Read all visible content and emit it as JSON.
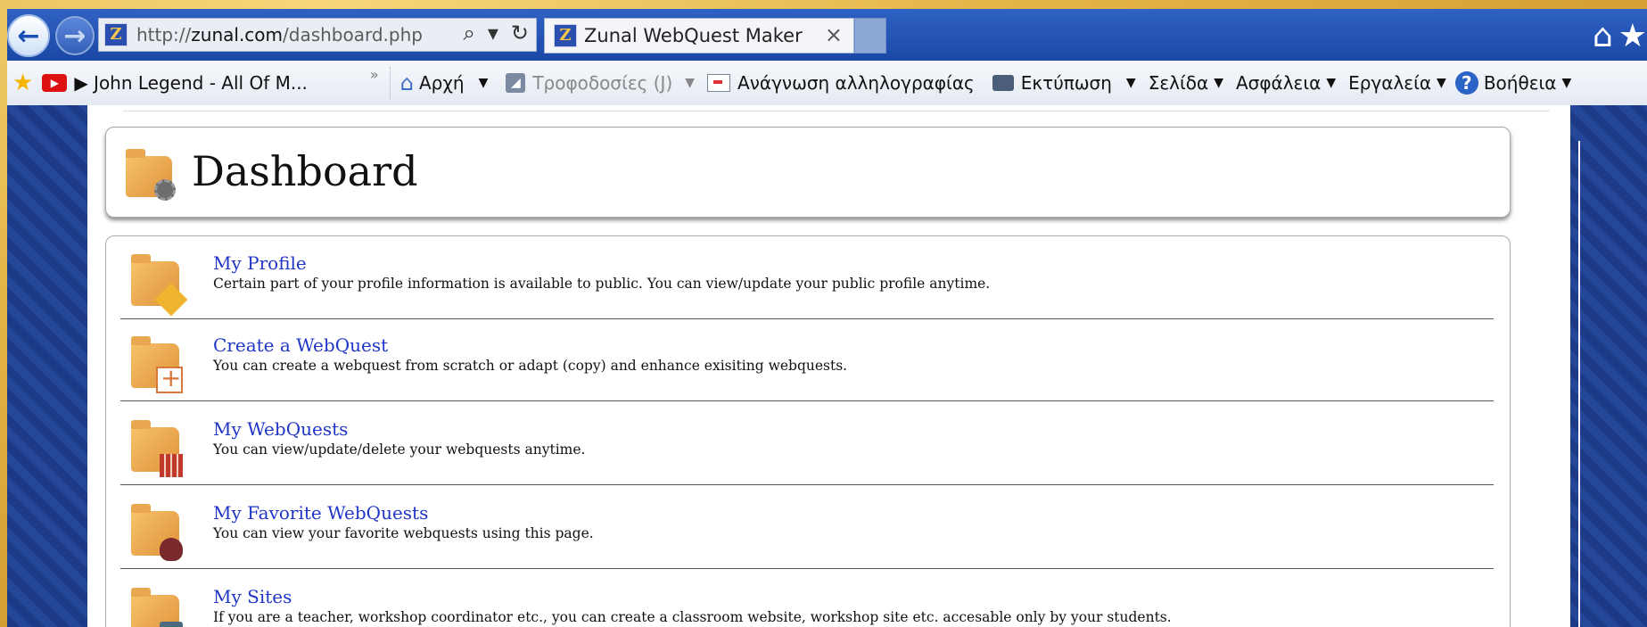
{
  "browser": {
    "url_prefix": "http://",
    "url_host": "zunal.com",
    "url_path": "/dashboard.php",
    "tab_title": "Zunal WebQuest Maker",
    "tab_close": "×",
    "search_glyph": "⌕",
    "dropdown_glyph": "▾",
    "refresh_glyph": "↻",
    "back_glyph": "←",
    "forward_glyph": "→",
    "home_glyph": "⌂",
    "star_glyph": "★"
  },
  "toolbar": {
    "favorite_label": "▶ John Legend - All Of M...",
    "more_glyph": "»",
    "home_label": "Αρχή",
    "feeds_label": "Τροφοδοσίες (J)",
    "mail_label": "Ανάγνωση αλληλογραφίας",
    "print_label": "Εκτύπωση",
    "page_label": "Σελίδα",
    "safety_label": "Ασφάλεια",
    "tools_label": "Εργαλεία",
    "help_label": "Βοήθεια",
    "dropdown_glyph": "▼"
  },
  "dashboard": {
    "title": "Dashboard",
    "items": [
      {
        "title": "My Profile",
        "description": "Certain part of your profile information is available to public. You can view/update your public profile anytime.",
        "icon": "profile-folder-icon"
      },
      {
        "title": "Create a WebQuest",
        "description": "You can create a webquest from scratch or adapt (copy) and enhance exisiting webquests.",
        "icon": "create-folder-icon"
      },
      {
        "title": "My WebQuests",
        "description": "You can view/update/delete your webquests anytime.",
        "icon": "webquests-folder-icon"
      },
      {
        "title": "My Favorite WebQuests",
        "description": "You can view your favorite webquests using this page.",
        "icon": "favorites-folder-icon"
      },
      {
        "title": "My Sites",
        "description": "If you are a teacher, workshop coordinator etc., you can create a classroom website, workshop site etc. accesable only by your students.",
        "icon": "sites-folder-icon"
      }
    ]
  }
}
